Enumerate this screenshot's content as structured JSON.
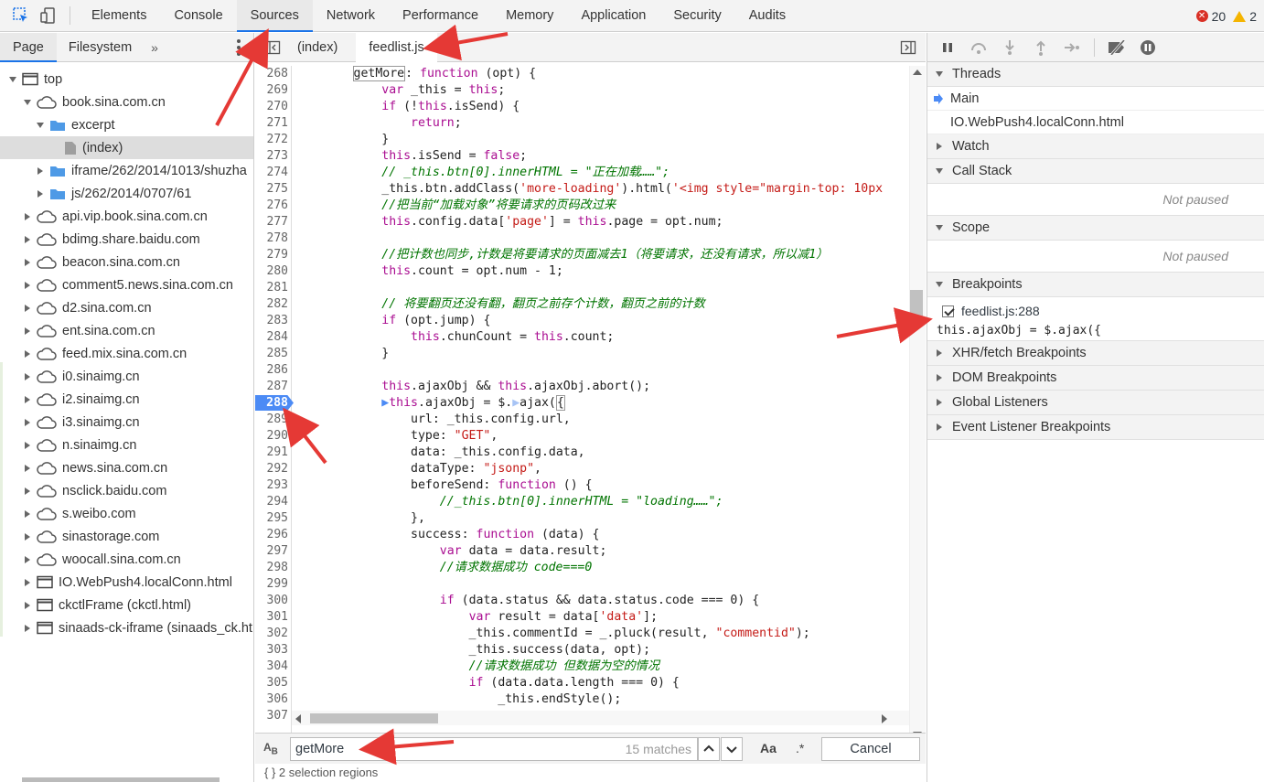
{
  "topbar": {
    "tabs": [
      "Elements",
      "Console",
      "Sources",
      "Network",
      "Performance",
      "Memory",
      "Application",
      "Security",
      "Audits"
    ],
    "active_tab": "Sources",
    "error_count": "20",
    "warning_count": "2"
  },
  "navigator": {
    "tabs": [
      "Page",
      "Filesystem"
    ],
    "more": "»",
    "tree": [
      {
        "label": "top",
        "depth": 0,
        "icon": "frame-icon",
        "expanded": true
      },
      {
        "label": "book.sina.com.cn",
        "depth": 1,
        "icon": "cloud-icon",
        "expanded": true
      },
      {
        "label": "excerpt",
        "depth": 2,
        "icon": "folder-icon",
        "expanded": true
      },
      {
        "label": "(index)",
        "depth": 3,
        "icon": "file-icon",
        "selected": true
      },
      {
        "label": "iframe/262/2014/1013/shuzha",
        "depth": 2,
        "icon": "folder-icon",
        "expanded": false
      },
      {
        "label": "js/262/2014/0707/61",
        "depth": 2,
        "icon": "folder-icon",
        "expanded": false
      },
      {
        "label": "api.vip.book.sina.com.cn",
        "depth": 1,
        "icon": "cloud-icon",
        "expanded": false
      },
      {
        "label": "bdimg.share.baidu.com",
        "depth": 1,
        "icon": "cloud-icon",
        "expanded": false
      },
      {
        "label": "beacon.sina.com.cn",
        "depth": 1,
        "icon": "cloud-icon",
        "expanded": false
      },
      {
        "label": "comment5.news.sina.com.cn",
        "depth": 1,
        "icon": "cloud-icon",
        "expanded": false
      },
      {
        "label": "d2.sina.com.cn",
        "depth": 1,
        "icon": "cloud-icon",
        "expanded": false
      },
      {
        "label": "ent.sina.com.cn",
        "depth": 1,
        "icon": "cloud-icon",
        "expanded": false
      },
      {
        "label": "feed.mix.sina.com.cn",
        "depth": 1,
        "icon": "cloud-icon",
        "expanded": false
      },
      {
        "label": "i0.sinaimg.cn",
        "depth": 1,
        "icon": "cloud-icon",
        "expanded": false
      },
      {
        "label": "i2.sinaimg.cn",
        "depth": 1,
        "icon": "cloud-icon",
        "expanded": false
      },
      {
        "label": "i3.sinaimg.cn",
        "depth": 1,
        "icon": "cloud-icon",
        "expanded": false
      },
      {
        "label": "n.sinaimg.cn",
        "depth": 1,
        "icon": "cloud-icon",
        "expanded": false
      },
      {
        "label": "news.sina.com.cn",
        "depth": 1,
        "icon": "cloud-icon",
        "expanded": false
      },
      {
        "label": "nsclick.baidu.com",
        "depth": 1,
        "icon": "cloud-icon",
        "expanded": false
      },
      {
        "label": "s.weibo.com",
        "depth": 1,
        "icon": "cloud-icon",
        "expanded": false
      },
      {
        "label": "sinastorage.com",
        "depth": 1,
        "icon": "cloud-icon",
        "expanded": false
      },
      {
        "label": "woocall.sina.com.cn",
        "depth": 1,
        "icon": "cloud-icon",
        "expanded": false
      },
      {
        "label": "IO.WebPush4.localConn.html",
        "depth": 1,
        "icon": "frame-icon",
        "expanded": false
      },
      {
        "label": "ckctlFrame (ckctl.html)",
        "depth": 1,
        "icon": "frame-icon",
        "expanded": false
      },
      {
        "label": "sinaads-ck-iframe (sinaads_ck.ht",
        "depth": 1,
        "icon": "frame-icon",
        "expanded": false
      }
    ]
  },
  "editor": {
    "tabs": [
      "(index)",
      "feedlist.js"
    ],
    "active_tab": "feedlist.js",
    "breakpoint_line": 288,
    "lines": [
      {
        "n": "268",
        "html": "        <span style=\"border:1px solid #999\">getMore</span>: <span class=\"kw\">function</span> (opt) {"
      },
      {
        "n": "269",
        "html": "            <span class=\"kw\">var</span> _this = <span class=\"kw\">this</span>;"
      },
      {
        "n": "270",
        "html": "            <span class=\"kw\">if</span> (!<span class=\"kw\">this</span>.isSend) {"
      },
      {
        "n": "271",
        "html": "                <span class=\"kw\">return</span>;"
      },
      {
        "n": "272",
        "html": "            }"
      },
      {
        "n": "273",
        "html": "            <span class=\"kw\">this</span>.isSend = <span class=\"kw\">false</span>;"
      },
      {
        "n": "274",
        "html": "            <span class=\"cm\">// _this.btn[0].innerHTML = \"正在加载……\";</span>"
      },
      {
        "n": "275",
        "html": "            _this.btn.addClass(<span class=\"str\">'more-loading'</span>).html(<span class=\"str\">'&lt;img style=\"margin-top: 10px</span>"
      },
      {
        "n": "276",
        "html": "            <span class=\"cm\">//把当前“加载对象”将要请求的页码改过来</span>"
      },
      {
        "n": "277",
        "html": "            <span class=\"kw\">this</span>.config.data[<span class=\"str\">'page'</span>] = <span class=\"kw\">this</span>.page = opt.num;"
      },
      {
        "n": "278",
        "html": ""
      },
      {
        "n": "279",
        "html": "            <span class=\"cm\">//把计数也同步,计数是将要请求的页面减去1（将要请求，还没有请求，所以减1）</span>"
      },
      {
        "n": "280",
        "html": "            <span class=\"kw\">this</span>.count = opt.num - 1;"
      },
      {
        "n": "281",
        "html": ""
      },
      {
        "n": "282",
        "html": "            <span class=\"cm\">// 将要翻页还没有翻，翻页之前存个计数，翻页之前的计数</span>"
      },
      {
        "n": "283",
        "html": "            <span class=\"kw\">if</span> (opt.jump) {"
      },
      {
        "n": "284",
        "html": "                <span class=\"kw\">this</span>.chunCount = <span class=\"kw\">this</span>.count;"
      },
      {
        "n": "285",
        "html": "            }"
      },
      {
        "n": "286",
        "html": ""
      },
      {
        "n": "287",
        "html": "            <span class=\"kw\">this</span>.ajaxObj &amp;&amp; <span class=\"kw\">this</span>.ajaxObj.abort();"
      },
      {
        "n": "288",
        "html": "            <span style=\"color:#4c8bf5\">▶</span><span class=\"kw\">this</span>.ajaxObj = $.<span style=\"color:#a8c4f5\">▶</span>ajax(<span style=\"border:1px solid #999\">{</span>"
      },
      {
        "n": "289",
        "html": "                url: _this.config.url,"
      },
      {
        "n": "290",
        "html": "                type: <span class=\"str\">\"GET\"</span>,"
      },
      {
        "n": "291",
        "html": "                data: _this.config.data,"
      },
      {
        "n": "292",
        "html": "                dataType: <span class=\"str\">\"jsonp\"</span>,"
      },
      {
        "n": "293",
        "html": "                beforeSend: <span class=\"kw\">function</span> () {"
      },
      {
        "n": "294",
        "html": "                    <span class=\"cm\">//_this.btn[0].innerHTML = \"loading……\";</span>"
      },
      {
        "n": "295",
        "html": "                },"
      },
      {
        "n": "296",
        "html": "                success: <span class=\"kw\">function</span> (data) {"
      },
      {
        "n": "297",
        "html": "                    <span class=\"kw\">var</span> data = data.result;"
      },
      {
        "n": "298",
        "html": "                    <span class=\"cm\">//请求数据成功 code===0</span>"
      },
      {
        "n": "299",
        "html": ""
      },
      {
        "n": "300",
        "html": "                    <span class=\"kw\">if</span> (data.status &amp;&amp; data.status.code === 0) {"
      },
      {
        "n": "301",
        "html": "                        <span class=\"kw\">var</span> result = data[<span class=\"str\">'data'</span>];"
      },
      {
        "n": "302",
        "html": "                        _this.commentId = _.pluck(result, <span class=\"str\">\"commentid\"</span>);"
      },
      {
        "n": "303",
        "html": "                        _this.success(data, opt);"
      },
      {
        "n": "304",
        "html": "                        <span class=\"cm\">//请求数据成功 但数据为空的情况</span>"
      },
      {
        "n": "305",
        "html": "                        <span class=\"kw\">if</span> (data.data.length === 0) {"
      },
      {
        "n": "306",
        "html": "                            _this.endStyle();"
      },
      {
        "n": "307",
        "html": ""
      }
    ],
    "search": {
      "value": "getMore",
      "count": "15 matches",
      "case_label": "Aa",
      "regex_label": ".*",
      "cancel_label": "Cancel"
    },
    "status": "{ }    2 selection regions"
  },
  "debugger": {
    "threads_label": "Threads",
    "threads": [
      "Main",
      "IO.WebPush4.localConn.html"
    ],
    "watch_label": "Watch",
    "callstack_label": "Call Stack",
    "callstack_state": "Not paused",
    "scope_label": "Scope",
    "scope_state": "Not paused",
    "breakpoints_label": "Breakpoints",
    "breakpoint_location": "feedlist.js:288",
    "breakpoint_code": "this.ajaxObj = $.ajax({",
    "sections": [
      "XHR/fetch Breakpoints",
      "DOM Breakpoints",
      "Global Listeners",
      "Event Listener Breakpoints"
    ]
  },
  "colors": {
    "accent": "#1a73e8",
    "breakpoint": "#4c8bf5",
    "annotation": "#e53935"
  }
}
